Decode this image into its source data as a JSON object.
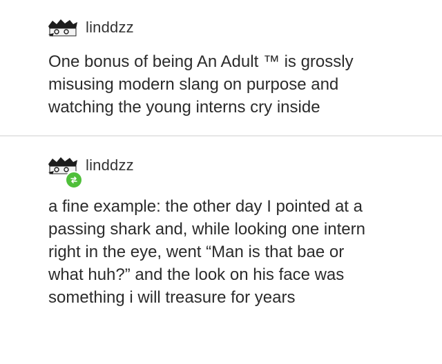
{
  "posts": [
    {
      "username": "linddzz",
      "avatar_icon": "drawn-face-avatar-icon",
      "body": "One bonus of being An Adult ™ is grossly\nmisusing modern slang on purpose and\nwatching the young interns cry inside"
    },
    {
      "username": "linddzz",
      "avatar_icon": "drawn-face-avatar-icon",
      "badge_icon": "reblog-icon",
      "badge_color": "#4fbf3a",
      "body": "a fine example: the other day I pointed at a\npassing shark and, while looking one intern\nright in the eye, went “Man is that bae or\nwhat huh?” and the look on his face was\nsomething i will treasure for years"
    }
  ]
}
